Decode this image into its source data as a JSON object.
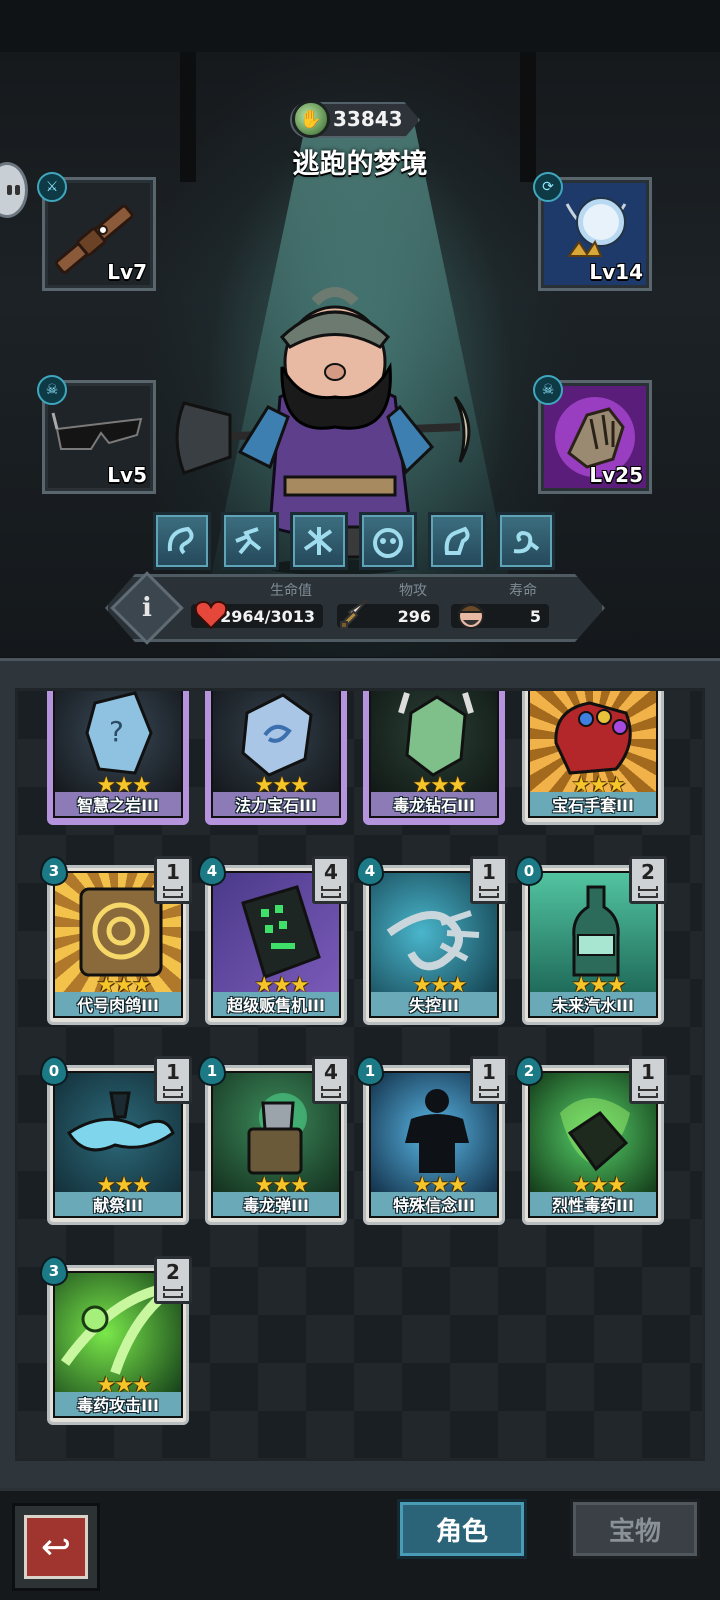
{
  "header": {
    "currency_value": "33843",
    "currency_icon": "soul-coin-icon",
    "stage_title": "逃跑的梦境"
  },
  "equipment": [
    {
      "slot": "weapon",
      "item": "dagger",
      "level": "Lv7"
    },
    {
      "slot": "necklace",
      "item": "moon-necklace",
      "level": "Lv14"
    },
    {
      "slot": "glasses",
      "item": "sunglasses",
      "level": "Lv5"
    },
    {
      "slot": "gloves",
      "item": "gauntlet",
      "level": "Lv25"
    }
  ],
  "skills": [
    "skill-1",
    "skill-2",
    "skill-3",
    "skill-4",
    "skill-5",
    "skill-6"
  ],
  "stats": {
    "hp_label": "生命值",
    "hp_value": "2964/3013",
    "atk_label": "物攻",
    "atk_value": "296",
    "life_label": "寿命",
    "life_value": "5"
  },
  "cards": [
    {
      "name": "智慧之岩III",
      "stars": "★★★",
      "rarity": "purple"
    },
    {
      "name": "法力宝石III",
      "stars": "★★★",
      "rarity": "purple"
    },
    {
      "name": "毒龙钻石III",
      "stars": "★★★",
      "rarity": "purple"
    },
    {
      "name": "宝石手套III",
      "stars": "★★★",
      "rarity": "teal"
    },
    {
      "name": "代号肉鸽III",
      "stars": "★★★",
      "cost": "3",
      "count": "1",
      "rarity": "teal"
    },
    {
      "name": "超级贩售机III",
      "stars": "★★★",
      "cost": "4",
      "count": "4",
      "rarity": "teal"
    },
    {
      "name": "失控III",
      "stars": "★★★",
      "cost": "4",
      "count": "1",
      "rarity": "teal"
    },
    {
      "name": "未来汽水III",
      "stars": "★★★",
      "cost": "0",
      "count": "2",
      "rarity": "teal"
    },
    {
      "name": "献祭III",
      "stars": "★★★",
      "cost": "0",
      "count": "1",
      "rarity": "teal"
    },
    {
      "name": "毒龙弹III",
      "stars": "★★★",
      "cost": "1",
      "count": "4",
      "rarity": "green"
    },
    {
      "name": "特殊信念III",
      "stars": "★★★",
      "cost": "1",
      "count": "1",
      "rarity": "teal"
    },
    {
      "name": "烈性毒药III",
      "stars": "★★★",
      "cost": "2",
      "count": "1",
      "rarity": "green"
    },
    {
      "name": "毒药攻击III",
      "stars": "★★★",
      "cost": "3",
      "count": "2",
      "rarity": "green"
    }
  ],
  "bottom_nav": {
    "back_icon": "back-arrow-icon",
    "tab_character": "角色",
    "tab_treasure": "宝物"
  }
}
